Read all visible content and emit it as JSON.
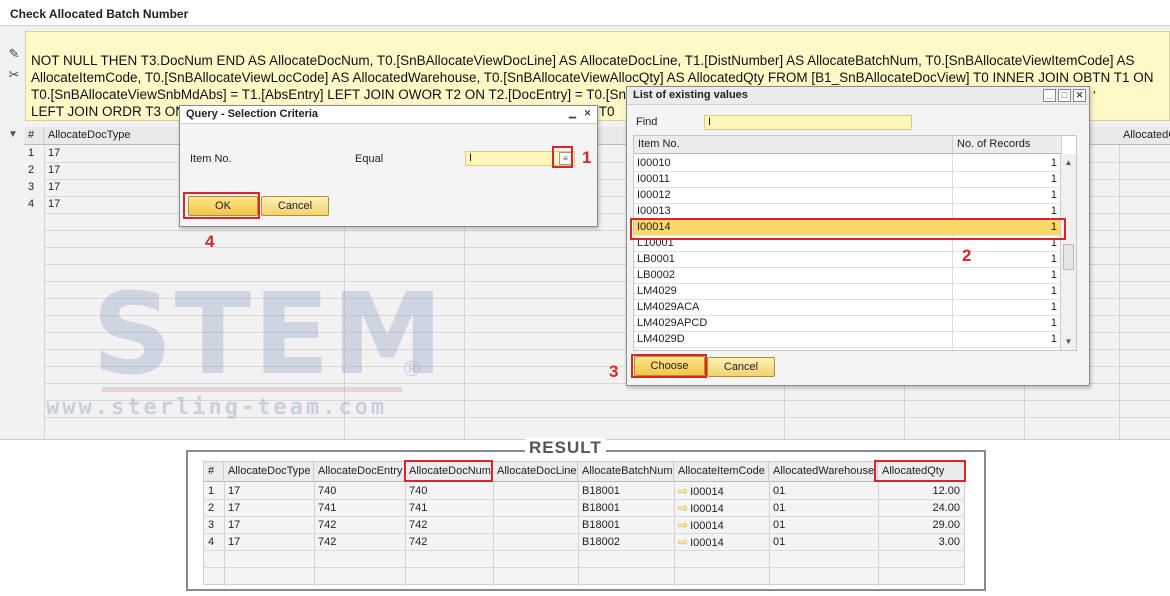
{
  "app": {
    "title": "Check Allocated Batch Number",
    "query_text": "NOT NULL THEN T3.DocNum END AS AllocateDocNum, T0.[SnBAllocateViewDocLine] AS AllocateDocLine, T1.[DistNumber] AS AllocateBatchNum, T0.[SnBAllocateViewItemCode] AS\nAllocateItemCode, T0.[SnBAllocateViewLocCode] AS AllocatedWarehouse, T0.[SnBAllocateViewAllocQty] AS AllocatedQty FROM [B1_SnBAllocateDocView] T0 INNER JOIN OBTN T1 ON\nT0.[SnBAllocateViewSnbMdAbs] = T1.[AbsEntry] LEFT JOIN OWOR T2 ON T2.[DocEntry] = T0.[SnBAllocateViewDocEntry] AND T0.[SnBAllocateViewDocType] = 202\nLEFT JOIN ORDR T3 ON T3.[DocEntry] = T0.[SnBAllocateViewDocEntry] AND T3.[ObjType] = T0",
    "query_tail": "'",
    "icons": [
      "pencil-icon",
      "scissors-icon"
    ]
  },
  "grid": {
    "headers": [
      "#",
      "AllocateDocType",
      "AllocatedC"
    ],
    "rows": [
      {
        "num": "1",
        "doc_type": "17"
      },
      {
        "num": "2",
        "doc_type": "17"
      },
      {
        "num": "3",
        "doc_type": "17"
      },
      {
        "num": "4",
        "doc_type": "17"
      }
    ]
  },
  "watermark": {
    "brand": "STEM",
    "reg": "®",
    "url": "www.sterling-team.com"
  },
  "selection_dialog": {
    "title": "Query - Selection Criteria",
    "field_label": "Item No.",
    "operator": "Equal",
    "value": "I",
    "ok_label": "OK",
    "cancel_label": "Cancel"
  },
  "list_dialog": {
    "title": "List of existing values",
    "find_label": "Find",
    "find_value": "I",
    "col_item": "Item No.",
    "col_records": "No. of Records",
    "items": [
      {
        "item": "I00010",
        "count": "1"
      },
      {
        "item": "I00011",
        "count": "1"
      },
      {
        "item": "I00012",
        "count": "1"
      },
      {
        "item": "I00013",
        "count": "1"
      },
      {
        "item": "I00014",
        "count": "1"
      },
      {
        "item": "L10001",
        "count": "1"
      },
      {
        "item": "LB0001",
        "count": "1"
      },
      {
        "item": "LB0002",
        "count": "1"
      },
      {
        "item": "LM4029",
        "count": "1"
      },
      {
        "item": "LM4029ACA",
        "count": "1"
      },
      {
        "item": "LM4029APCD",
        "count": "1"
      },
      {
        "item": "LM4029D",
        "count": "1"
      }
    ],
    "selected_item": "I00014",
    "choose_label": "Choose",
    "cancel_label": "Cancel"
  },
  "steps": {
    "s1": "1",
    "s2": "2",
    "s3": "3",
    "s4": "4"
  },
  "result": {
    "title": "RESULT",
    "headers": [
      "#",
      "AllocateDocType",
      "AllocateDocEntry",
      "AllocateDocNum",
      "AllocateDocLine",
      "AllocateBatchNum",
      "AllocateItemCode",
      "AllocatedWarehouse",
      "AllocatedQty"
    ],
    "rows": [
      {
        "num": "1",
        "doc_type": "17",
        "doc_entry": "740",
        "doc_num": "740",
        "doc_line": "",
        "batch": "B18001",
        "item": "I00014",
        "warehouse": "01",
        "qty": "12.00"
      },
      {
        "num": "2",
        "doc_type": "17",
        "doc_entry": "741",
        "doc_num": "741",
        "doc_line": "",
        "batch": "B18001",
        "item": "I00014",
        "warehouse": "01",
        "qty": "24.00"
      },
      {
        "num": "3",
        "doc_type": "17",
        "doc_entry": "742",
        "doc_num": "742",
        "doc_line": "",
        "batch": "B18001",
        "item": "I00014",
        "warehouse": "01",
        "qty": "29.00"
      },
      {
        "num": "4",
        "doc_type": "17",
        "doc_entry": "742",
        "doc_num": "742",
        "doc_line": "",
        "batch": "B18002",
        "item": "I00014",
        "warehouse": "01",
        "qty": "3.00"
      }
    ]
  },
  "colors": {
    "highlight_red": "#d9262b",
    "button_yellow": "#f3c44a",
    "query_bg": "#fff9c8",
    "selected_row": "#fcd86a"
  }
}
